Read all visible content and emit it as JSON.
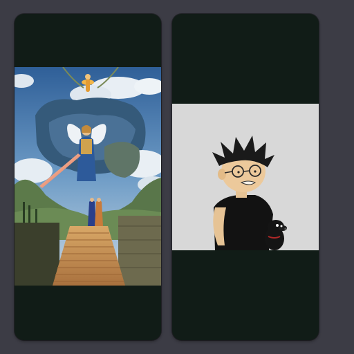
{
  "gallery": {
    "cards": [
      {
        "image_icon": "painting-angel-staircase-icon",
        "colors": {
          "sky": "#3d6fa8",
          "clouds": "#dfe6ee",
          "stairs": "#c48a4e",
          "robe": "#2d5a9a",
          "gold": "#e0a838"
        }
      },
      {
        "image_icon": "cartoon-boy-glasses-dog-icon",
        "colors": {
          "background": "#d8d8d8",
          "shirt": "#111111",
          "skin": "#e8c79a",
          "hair": "#1a1a1a"
        }
      }
    ],
    "colors": {
      "page_background": "#3c3c45",
      "card_background": "#111c17"
    }
  }
}
